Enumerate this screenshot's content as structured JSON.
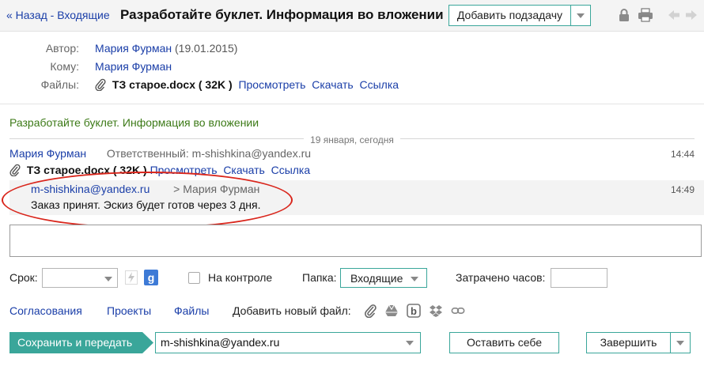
{
  "header": {
    "back_label": "« Назад - Входящие",
    "title": "Разработайте буклет. Информация во вложении",
    "add_subtask_label": "Добавить подзадачу"
  },
  "meta": {
    "author_label": "Автор:",
    "author_name": "Мария Фурман",
    "author_date": "(19.01.2015)",
    "to_label": "Кому:",
    "to_name": "Мария Фурман",
    "files_label": "Файлы:",
    "file_name": "ТЗ старое.docx ( 32K )",
    "view_label": "Просмотреть",
    "download_label": "Скачать",
    "link_label": "Ссылка"
  },
  "subject": "Разработайте буклет. Информация во вложении",
  "date_separator": "19 января, сегодня",
  "messages": [
    {
      "sender": "Мария Фурман",
      "info": "Ответственный: m-shishkina@yandex.ru",
      "time": "14:44",
      "file_name": "ТЗ старое.docx ( 32K )",
      "view_label": "Просмотреть",
      "download_label": "Скачать",
      "link_label": "Ссылка"
    },
    {
      "sender": "m-shishkina@yandex.ru",
      "recipient": "> Мария Фурман",
      "time": "14:49",
      "text": "Заказ принят. Эскиз будет готов через 3 дня."
    }
  ],
  "controls": {
    "deadline_label": "Срок:",
    "deadline_value": "",
    "control_label": "На контроле",
    "folder_label": "Папка:",
    "folder_value": "Входящие",
    "hours_label": "Затрачено часов:",
    "hours_value": ""
  },
  "tabs": {
    "approvals": "Согласования",
    "projects": "Проекты",
    "files": "Файлы",
    "add_file_label": "Добавить новый файл:"
  },
  "footer": {
    "send_label": "Сохранить и передать",
    "recipient_value": "m-shishkina@yandex.ru",
    "keep_label": "Оставить себе",
    "finish_label": "Завершить"
  },
  "colors": {
    "accent_teal": "#3aa69a",
    "link_blue": "#1a3ea8",
    "subject_green": "#3c7a17",
    "highlight_red": "#d9261c"
  }
}
